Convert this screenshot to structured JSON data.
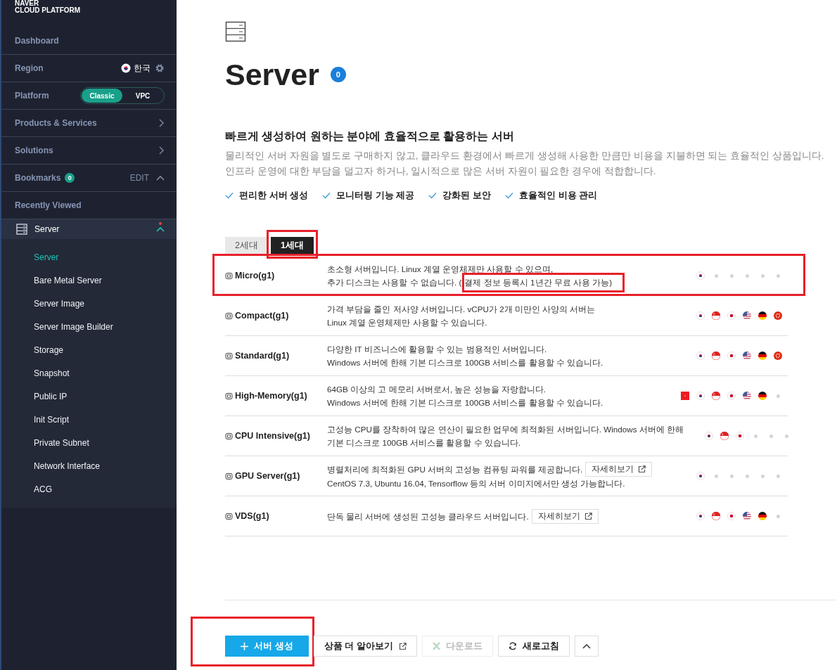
{
  "sidebar": {
    "logo": [
      "NAVER",
      "CLOUD PLATFORM"
    ],
    "items": [
      {
        "kind": "link",
        "label": "Dashboard"
      },
      {
        "kind": "region",
        "label": "Region",
        "value": "한국"
      },
      {
        "kind": "platform",
        "label": "Platform",
        "options": [
          {
            "label": "Classic",
            "selected": true
          },
          {
            "label": "VPC",
            "selected": false
          }
        ]
      },
      {
        "kind": "menu",
        "label": "Products & Services"
      },
      {
        "kind": "menu",
        "label": "Solutions"
      },
      {
        "kind": "bookmarks",
        "label": "Bookmarks",
        "count": "0",
        "action": "EDIT",
        "expanded": true
      },
      {
        "kind": "link",
        "label": "Recently Viewed"
      },
      {
        "kind": "group",
        "label": "Server",
        "new": true,
        "expanded": true,
        "children": [
          {
            "label": "Server",
            "selected": true
          },
          {
            "label": "Bare Metal Server",
            "selected": false
          },
          {
            "label": "Server Image",
            "selected": false
          },
          {
            "label": "Server Image Builder",
            "selected": false
          },
          {
            "label": "Storage",
            "selected": false
          },
          {
            "label": "Snapshot",
            "selected": false
          },
          {
            "label": "Public IP",
            "selected": false
          },
          {
            "label": "Init Script",
            "selected": false
          },
          {
            "label": "Private Subnet",
            "selected": false
          },
          {
            "label": "Network Interface",
            "selected": false
          },
          {
            "label": "ACG",
            "selected": false
          }
        ]
      }
    ]
  },
  "header": {
    "title": "Server",
    "count": "0",
    "headline": "빠르게 생성하여 원하는 분야에 효율적으로 활용하는 서버",
    "description": [
      "물리적인 서버 자원을 별도로 구매하지 않고, 클라우드 환경에서 빠르게 생성해 사용한 만큼만 비용을 지불하면 되는 효율적인 상품입니다.",
      "인프라 운영에 대한 부담을 덜고자 하거나, 일시적으로 많은 서버 자원이 필요한 경우에 적합합니다."
    ],
    "features": [
      "편리한 서버 생성",
      "모니터링 기능 제공",
      "강화된 보안",
      "효율적인 비용 관리"
    ]
  },
  "tabs": [
    {
      "label": "2세대",
      "selected": false,
      "highlighted": false
    },
    {
      "label": "1세대",
      "selected": true,
      "highlighted": true
    }
  ],
  "products": [
    {
      "name": "Micro(g1)",
      "highlighted": true,
      "lines": [
        "초소형 서버입니다. Linux 계열 운영체제만 사용할 수 있으며,",
        "추가 디스크는 사용할 수 없습니다. ("
      ],
      "note": "결제 정보 등록시 1년간 무료 사용 가능)",
      "regions": [
        {
          "kind": "kr",
          "available": true
        },
        {
          "available": false
        },
        {
          "available": false
        },
        {
          "available": false
        },
        {
          "available": false
        },
        {
          "available": false
        }
      ]
    },
    {
      "name": "Compact(g1)",
      "highlighted": false,
      "lines": [
        "가격 부담을 줄인 저사양 서버입니다. vCPU가 2개 미만인 사양의 서버는",
        "Linux 계열 운영체제만 사용할 수 있습니다."
      ],
      "regions": [
        {
          "kind": "kr",
          "available": true
        },
        {
          "kind": "sg",
          "available": true
        },
        {
          "kind": "jp",
          "available": true
        },
        {
          "kind": "us",
          "available": true
        },
        {
          "kind": "de",
          "available": true
        },
        {
          "kind": "hk",
          "available": true
        }
      ]
    },
    {
      "name": "Standard(g1)",
      "highlighted": false,
      "lines": [
        "다양한 IT 비즈니스에 활용할 수 있는 범용적인 서버입니다.",
        "Windows 서버에 한해 기본 디스크로 100GB 서비스를 활용할 수 있습니다."
      ],
      "regions": [
        {
          "kind": "kr",
          "available": true
        },
        {
          "kind": "sg",
          "available": true
        },
        {
          "kind": "jp",
          "available": true
        },
        {
          "kind": "us",
          "available": true
        },
        {
          "kind": "de",
          "available": true
        },
        {
          "kind": "hk",
          "available": true
        }
      ]
    },
    {
      "name": "High-Memory(g1)",
      "highlighted": false,
      "lines": [
        "64GB 이상의 고 메모리 서버로서, 높은 성능을 자랑합니다.",
        "Windows 서버에 한해 기본 디스크로 100GB 서비스를 활용할 수 있습니다."
      ],
      "regions": [
        {
          "kind": "cn",
          "available": true
        },
        {
          "kind": "kr",
          "available": true
        },
        {
          "kind": "sg",
          "available": true
        },
        {
          "kind": "jp",
          "available": true
        },
        {
          "kind": "us",
          "available": true
        },
        {
          "kind": "de",
          "available": true
        },
        {
          "available": false
        }
      ]
    },
    {
      "name": "CPU Intensive(g1)",
      "highlighted": false,
      "lines": [
        "고성능 CPU를 장착하여 많은 연산이 필요한 업무에 최적화된 서버입니다. Windows 서버에 한해",
        "기본 디스크로 100GB 서비스를 활용할 수 있습니다."
      ],
      "regions": [
        {
          "kind": "kr",
          "available": true
        },
        {
          "kind": "sg",
          "available": true
        },
        {
          "kind": "jp",
          "available": true
        },
        {
          "available": false
        },
        {
          "available": false
        },
        {
          "available": false
        }
      ]
    },
    {
      "name": "GPU Server(g1)",
      "highlighted": false,
      "lines": [
        "병렬처리에 최적화된 GPU 서버의 고성능 컴퓨팅 파워를 제공합니다.",
        "CentOS 7.3, Ubuntu 16.04, Tensorflow 등의 서버 이미지에서만 생성 가능합니다."
      ],
      "link": "자세히보기",
      "regions": [
        {
          "kind": "kr",
          "available": true
        },
        {
          "available": false
        },
        {
          "available": false
        },
        {
          "available": false
        },
        {
          "available": false
        },
        {
          "available": false
        }
      ]
    },
    {
      "name": "VDS(g1)",
      "highlighted": false,
      "lines": [
        "단독 물리 서버에 생성된 고성능 클라우드 서버입니다."
      ],
      "link": "자세히보기",
      "regions": [
        {
          "kind": "kr",
          "available": true
        },
        {
          "kind": "sg",
          "available": true
        },
        {
          "kind": "jp",
          "available": true
        },
        {
          "kind": "us",
          "available": true
        },
        {
          "kind": "de",
          "available": true
        },
        {
          "available": false
        }
      ]
    }
  ],
  "actions": [
    {
      "kind": "create",
      "label": "서버 생성",
      "disabled": false,
      "highlighted": true
    },
    {
      "kind": "learn",
      "label": "상품 더 알아보기",
      "disabled": false,
      "highlighted": false
    },
    {
      "kind": "download",
      "label": "다운로드",
      "disabled": true,
      "highlighted": false
    },
    {
      "kind": "refresh",
      "label": "새로고침",
      "disabled": false,
      "highlighted": false
    },
    {
      "kind": "collapse",
      "disabled": false,
      "highlighted": false
    }
  ]
}
